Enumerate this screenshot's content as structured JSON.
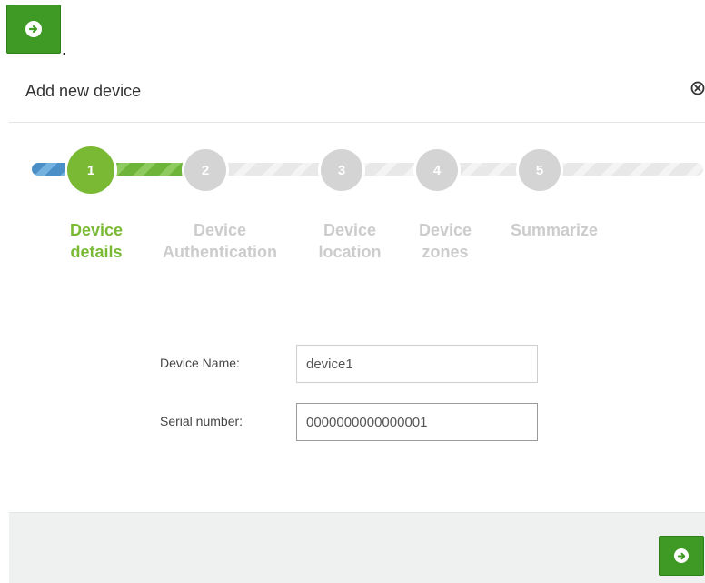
{
  "toolbar": {
    "top_button_icon": "arrow-right-circle-icon",
    "dot_text": "."
  },
  "modal": {
    "title": "Add new device",
    "close_icon": "close-circle-icon"
  },
  "wizard": {
    "current_step": 1,
    "steps": [
      {
        "number": "1",
        "label_line1": "Device",
        "label_line2": "details",
        "state": "active"
      },
      {
        "number": "2",
        "label_line1": "Device",
        "label_line2": "Authentication",
        "state": "inactive"
      },
      {
        "number": "3",
        "label_line1": "Device",
        "label_line2": "location",
        "state": "inactive"
      },
      {
        "number": "4",
        "label_line1": "Device",
        "label_line2": "zones",
        "state": "inactive"
      },
      {
        "number": "5",
        "label_line1": "Summarize",
        "label_line2": "",
        "state": "inactive"
      }
    ]
  },
  "form": {
    "device_name_label": "Device Name:",
    "device_name_value": "device1",
    "serial_label": "Serial number:",
    "serial_value": "0000000000000001"
  },
  "footer": {
    "next_button_icon": "arrow-right-circle-icon"
  },
  "colors": {
    "accent_green": "#3e9a24",
    "active_step": "#7ab934",
    "inactive_step": "#d4d4d4",
    "blue_track": "#4a8fc5",
    "footer_bg": "#eff1f1"
  }
}
